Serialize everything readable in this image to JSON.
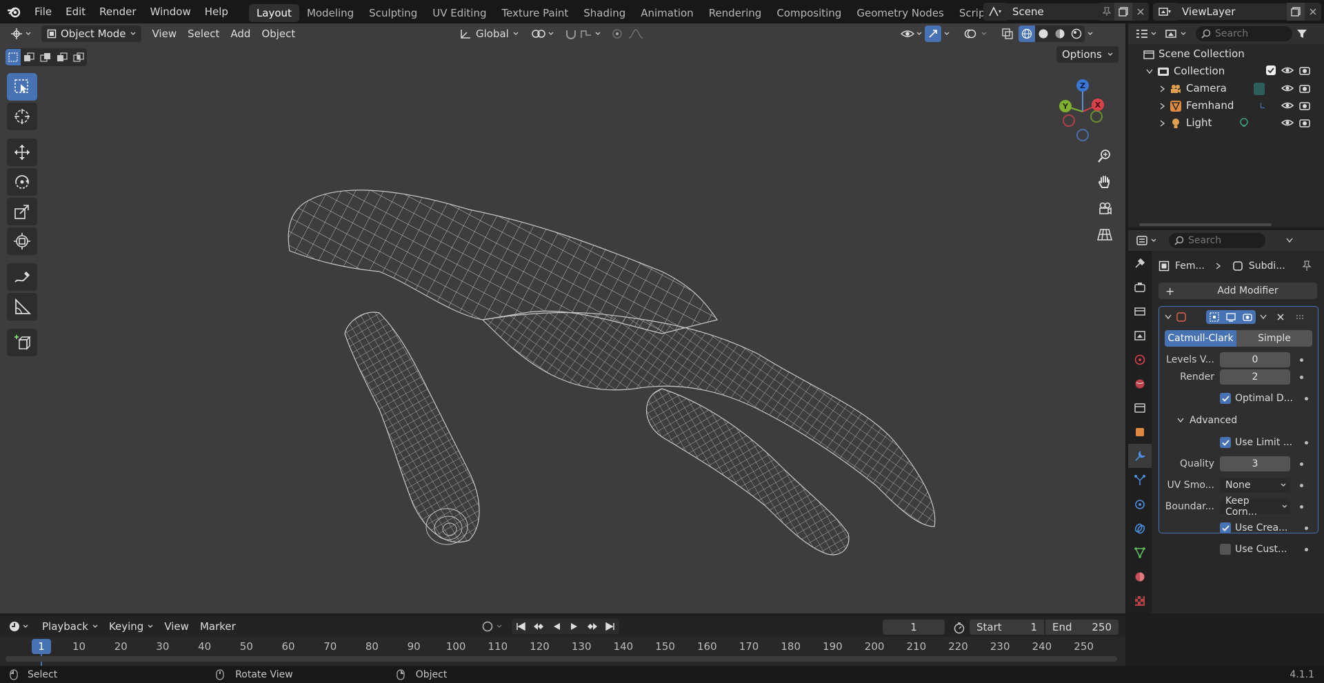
{
  "menu": [
    "File",
    "Edit",
    "Render",
    "Window",
    "Help"
  ],
  "workspaces": [
    "Layout",
    "Modeling",
    "Sculpting",
    "UV Editing",
    "Texture Paint",
    "Shading",
    "Animation",
    "Rendering",
    "Compositing",
    "Geometry Nodes",
    "Scripting"
  ],
  "active_workspace": "Layout",
  "scene": "Scene",
  "view_layer": "ViewLayer",
  "viewport": {
    "mode": "Object Mode",
    "menus": [
      "View",
      "Select",
      "Add",
      "Object"
    ],
    "transform_orientation": "Global",
    "options_label": "Options",
    "gizmo_axes": {
      "z": "Z",
      "y": "Y",
      "x": "X"
    }
  },
  "outliner": {
    "search_placeholder": "Search",
    "scene_collection": "Scene Collection",
    "collection": "Collection",
    "items": [
      "Camera",
      "Femhand",
      "Light"
    ]
  },
  "properties": {
    "search_placeholder": "Search",
    "breadcrumb_object": "Fem...",
    "breadcrumb_modifier": "Subdi...",
    "add_modifier": "Add Modifier",
    "subdiv_types": [
      "Catmull-Clark",
      "Simple"
    ],
    "active_subdiv_type": "Catmull-Clark",
    "levels_viewport_label": "Levels V...",
    "levels_viewport": "0",
    "render_label": "Render",
    "render_value": "2",
    "optimal_display": "Optimal D...",
    "advanced_label": "Advanced",
    "use_limit": "Use Limit ...",
    "quality_label": "Quality",
    "quality_value": "3",
    "uv_smooth_label": "UV Smo...",
    "uv_smooth_value": "None",
    "boundary_label": "Boundar...",
    "boundary_value": "Keep Corn...",
    "use_creases": "Use Crea...",
    "use_custom": "Use Cust..."
  },
  "timeline": {
    "menus": [
      "Playback",
      "Keying",
      "View",
      "Marker"
    ],
    "current_frame": "1",
    "start_label": "Start",
    "start": "1",
    "end_label": "End",
    "end": "250",
    "ruler": [
      "1",
      "10",
      "20",
      "30",
      "40",
      "50",
      "60",
      "70",
      "80",
      "90",
      "100",
      "110",
      "120",
      "130",
      "140",
      "150",
      "160",
      "170",
      "180",
      "190",
      "200",
      "210",
      "220",
      "230",
      "240",
      "250"
    ]
  },
  "status": {
    "select": "Select",
    "rotate": "Rotate View",
    "object": "Object",
    "version": "4.1.1"
  },
  "colors": {
    "accent": "#4772b3",
    "viewport_bg": "#3d3d3d",
    "panel_bg": "#282828",
    "wire": "#c8c8c8"
  }
}
